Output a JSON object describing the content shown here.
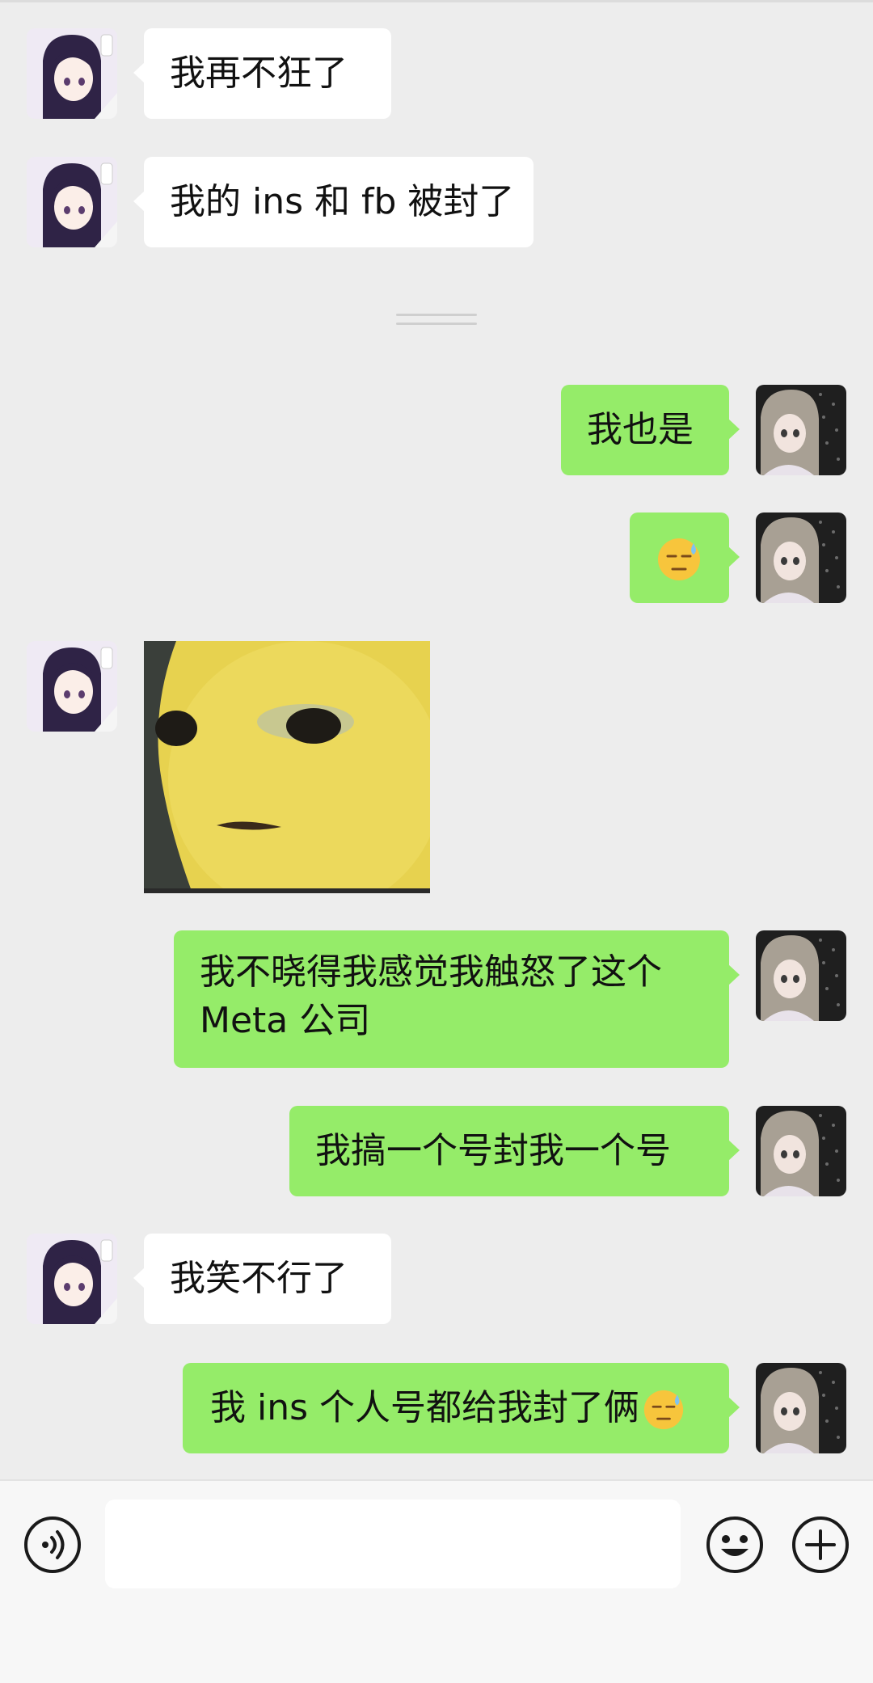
{
  "messages": [
    {
      "id": "m1",
      "side": "left",
      "text": "我再不狂了"
    },
    {
      "id": "m2",
      "side": "left",
      "text": "我的 ins 和 fb 被封了"
    },
    {
      "id": "m3",
      "side": "right",
      "text": "我也是"
    },
    {
      "id": "m4",
      "side": "right",
      "emoji": "sweat-smile-emoji"
    },
    {
      "id": "m5",
      "side": "left",
      "sticker": "sad-yellow-creature-sticker"
    },
    {
      "id": "m6",
      "side": "right",
      "text": "我不晓得我感觉我触怒了这个 Meta 公司"
    },
    {
      "id": "m7",
      "side": "right",
      "text": "我搞一个号封我一个号"
    },
    {
      "id": "m8",
      "side": "left",
      "text": "我笑不行了"
    },
    {
      "id": "m9",
      "side": "right",
      "text": "我 ins 个人号都给我封了俩",
      "trailing_emoji": "sweat-smile-emoji"
    }
  ],
  "input_bar": {
    "message_value": "",
    "icons": [
      "voice-icon",
      "emoji-face-icon",
      "plus-icon"
    ]
  },
  "colors": {
    "background": "#ededed",
    "incoming_bubble": "#ffffff",
    "outgoing_bubble": "#95ec69"
  }
}
